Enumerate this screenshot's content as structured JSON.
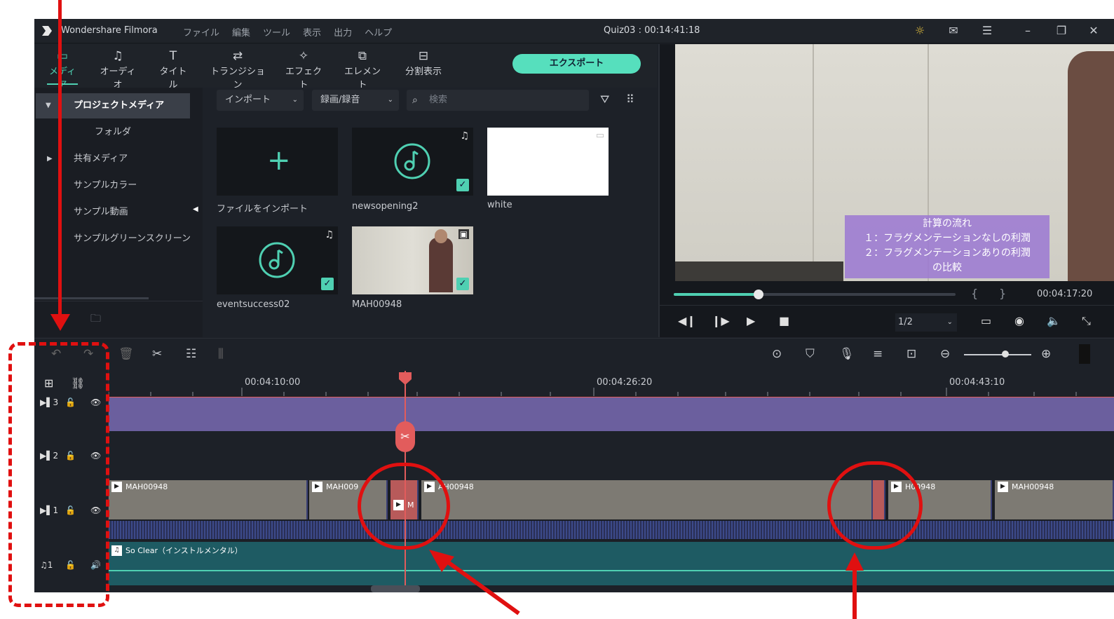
{
  "titlebar": {
    "app_name": "Wondershare Filmora",
    "menu": [
      "ファイル",
      "編集",
      "ツール",
      "表示",
      "出力",
      "ヘルプ"
    ],
    "project": "Quiz03 : 00:14:41:18"
  },
  "toolbar": {
    "tabs": [
      {
        "icon": "media-icon",
        "label": "メディア"
      },
      {
        "icon": "audio-icon",
        "label": "オーディオ"
      },
      {
        "icon": "title-icon",
        "label": "タイトル"
      },
      {
        "icon": "transition-icon",
        "label": "トランジション"
      },
      {
        "icon": "effect-icon",
        "label": "エフェクト"
      },
      {
        "icon": "element-icon",
        "label": "エレメント"
      },
      {
        "icon": "splitscreen-icon",
        "label": "分割表示"
      }
    ],
    "export_label": "エクスポート"
  },
  "library": {
    "items": [
      {
        "label": "プロジェクトメディア",
        "arrow": "▼"
      },
      {
        "label": "フォルダ",
        "arrow": ""
      },
      {
        "label": "共有メディア",
        "arrow": "▶"
      },
      {
        "label": "サンプルカラー",
        "arrow": ""
      },
      {
        "label": "サンプル動画",
        "arrow": ""
      },
      {
        "label": "サンプルグリーンスクリーン",
        "arrow": ""
      }
    ]
  },
  "media": {
    "import_dropdown": "インポート",
    "record_dropdown": "録画/録音",
    "search_placeholder": "検索",
    "items": [
      {
        "label": "ファイルをインポート"
      },
      {
        "label": "newsopening2"
      },
      {
        "label": "white"
      },
      {
        "label": "eventsuccess02"
      },
      {
        "label": "MAH00948"
      }
    ]
  },
  "preview": {
    "caption_lines": [
      "計算の流れ",
      "１：フラグメンテーションなしの利潤",
      "２：フラグメンテーションありの利潤",
      "の比較"
    ],
    "timecode": "00:04:17:20",
    "progress": 0.3,
    "quality": "1/2",
    "bracket_in": "{",
    "bracket_out": "}"
  },
  "timeline": {
    "ruler_labels": [
      "00:04:10:00",
      "00:04:26:20",
      "00:04:43:10"
    ],
    "tracks": [
      {
        "label": "3"
      },
      {
        "label": "2"
      },
      {
        "label": "1"
      },
      {
        "label": "1"
      }
    ],
    "video_clips": [
      {
        "name": "MAH00948"
      },
      {
        "name": "MAH009"
      },
      {
        "name": "M"
      },
      {
        "name": "AH00948"
      },
      {
        "name": "H00948"
      },
      {
        "name": "MAH00948"
      }
    ],
    "audio_clip": "So Clear（インストルメンタル）"
  },
  "colors": {
    "accent": "#4fd0b2",
    "overlay_track": "#6b5f9e",
    "audio_track": "#1e5b63",
    "annotation": "#e01010",
    "playhead": "#e25c5c"
  }
}
